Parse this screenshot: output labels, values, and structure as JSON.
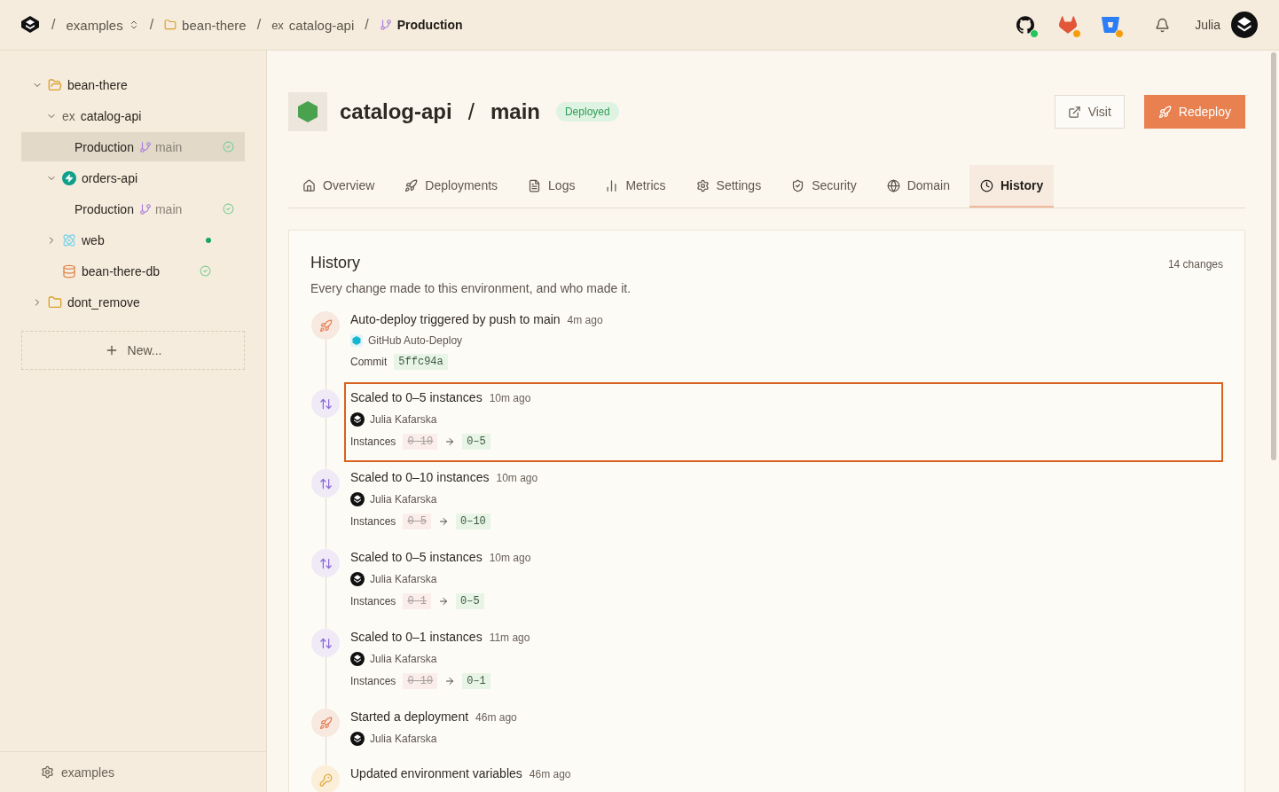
{
  "breadcrumb": {
    "separator": "/",
    "org": "examples",
    "project": "bean-there",
    "service_prefix": "ex",
    "service": "catalog-api",
    "environment": "Production"
  },
  "integrations": [
    {
      "kind": "github",
      "color": "#22c55e"
    },
    {
      "kind": "gitlab",
      "color": "#f59e0b"
    },
    {
      "kind": "bitbucket",
      "color": "#f59e0b"
    }
  ],
  "user": {
    "name": "Julia"
  },
  "sidebar": {
    "tree": [
      {
        "label": "bean-there",
        "kind": "folder",
        "expanded": true,
        "children": [
          {
            "label": "catalog-api",
            "kind": "ex",
            "prefix": "ex",
            "expanded": true,
            "children": [
              {
                "label": "Production",
                "kind": "env",
                "branch": "main",
                "healthy": true,
                "selected": true
              }
            ]
          },
          {
            "label": "orders-api",
            "kind": "bolt",
            "expanded": true,
            "children": [
              {
                "label": "Production",
                "kind": "env",
                "branch": "main",
                "healthy": true,
                "selected": false
              }
            ]
          },
          {
            "label": "web",
            "kind": "react",
            "expanded": false,
            "running": true
          },
          {
            "label": "bean-there-db",
            "kind": "db",
            "healthy": true
          }
        ]
      },
      {
        "label": "dont_remove",
        "kind": "folder",
        "expanded": false
      }
    ],
    "new_button": "New...",
    "footer": "examples"
  },
  "page": {
    "service": "catalog-api",
    "separator": "/",
    "branch": "main",
    "badge": "Deployed",
    "visit": "Visit",
    "redeploy": "Redeploy"
  },
  "tabs": [
    {
      "label": "Overview",
      "selected": false
    },
    {
      "label": "Deployments",
      "selected": false
    },
    {
      "label": "Logs",
      "selected": false
    },
    {
      "label": "Metrics",
      "selected": false
    },
    {
      "label": "Settings",
      "selected": false
    },
    {
      "label": "Security",
      "selected": false
    },
    {
      "label": "Domain",
      "selected": false
    },
    {
      "label": "History",
      "selected": true
    }
  ],
  "history": {
    "title": "History",
    "count": "14 changes",
    "subtitle": "Every change made to this environment, and who made it.",
    "events": [
      {
        "kind": "deploy",
        "title": "Auto-deploy triggered by push to main",
        "time": "4m ago",
        "author": "GitHub Auto-Deploy",
        "bot": true,
        "detail_label": "Commit",
        "commit": "5ffc94a",
        "selected": false
      },
      {
        "kind": "scale",
        "title": "Scaled to 0–5 instances",
        "time": "10m ago",
        "author": "Julia Kafarska",
        "bot": false,
        "detail_label": "Instances",
        "from": "0–10",
        "to": "0–5",
        "selected": true
      },
      {
        "kind": "scale",
        "title": "Scaled to 0–10 instances",
        "time": "10m ago",
        "author": "Julia Kafarska",
        "bot": false,
        "detail_label": "Instances",
        "from": "0–5",
        "to": "0–10",
        "selected": false
      },
      {
        "kind": "scale",
        "title": "Scaled to 0–5 instances",
        "time": "10m ago",
        "author": "Julia Kafarska",
        "bot": false,
        "detail_label": "Instances",
        "from": "0–1",
        "to": "0–5",
        "selected": false
      },
      {
        "kind": "scale",
        "title": "Scaled to 0–1 instances",
        "time": "11m ago",
        "author": "Julia Kafarska",
        "bot": false,
        "detail_label": "Instances",
        "from": "0–10",
        "to": "0–1",
        "selected": false
      },
      {
        "kind": "deploy",
        "title": "Started a deployment",
        "time": "46m ago",
        "author": "Julia Kafarska",
        "bot": false,
        "selected": false
      },
      {
        "kind": "env",
        "title": "Updated environment variables",
        "time": "46m ago",
        "selected": false
      }
    ]
  }
}
